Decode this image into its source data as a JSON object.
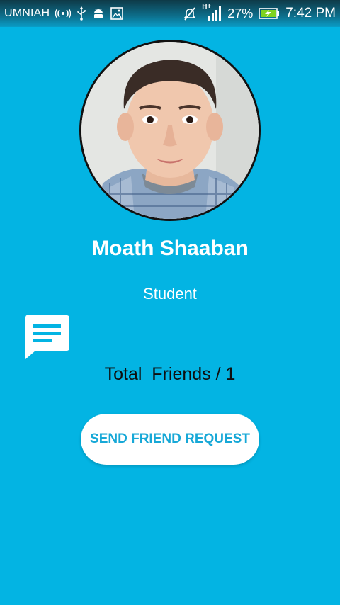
{
  "status_bar": {
    "carrier": "UMNIAH",
    "network_badge": "H+",
    "battery_percent": "27%",
    "time": "7:42 PM",
    "icons": [
      "broadcast-icon",
      "usb-icon",
      "android-debug-icon",
      "image-icon",
      "mute-icon",
      "signal-icon",
      "battery-charging-icon"
    ]
  },
  "profile": {
    "name": "Moath Shaaban",
    "role": "Student",
    "friends_text": "Total  Friends / 1"
  },
  "actions": {
    "send_request_label": "SEND FRIEND REQUEST",
    "chat_icon": "chat-message-icon"
  },
  "colors": {
    "background": "#03B4E3",
    "button_text": "#17A8D7",
    "text_white": "#FFFFFF",
    "text_dark": "#0F0F0F"
  }
}
